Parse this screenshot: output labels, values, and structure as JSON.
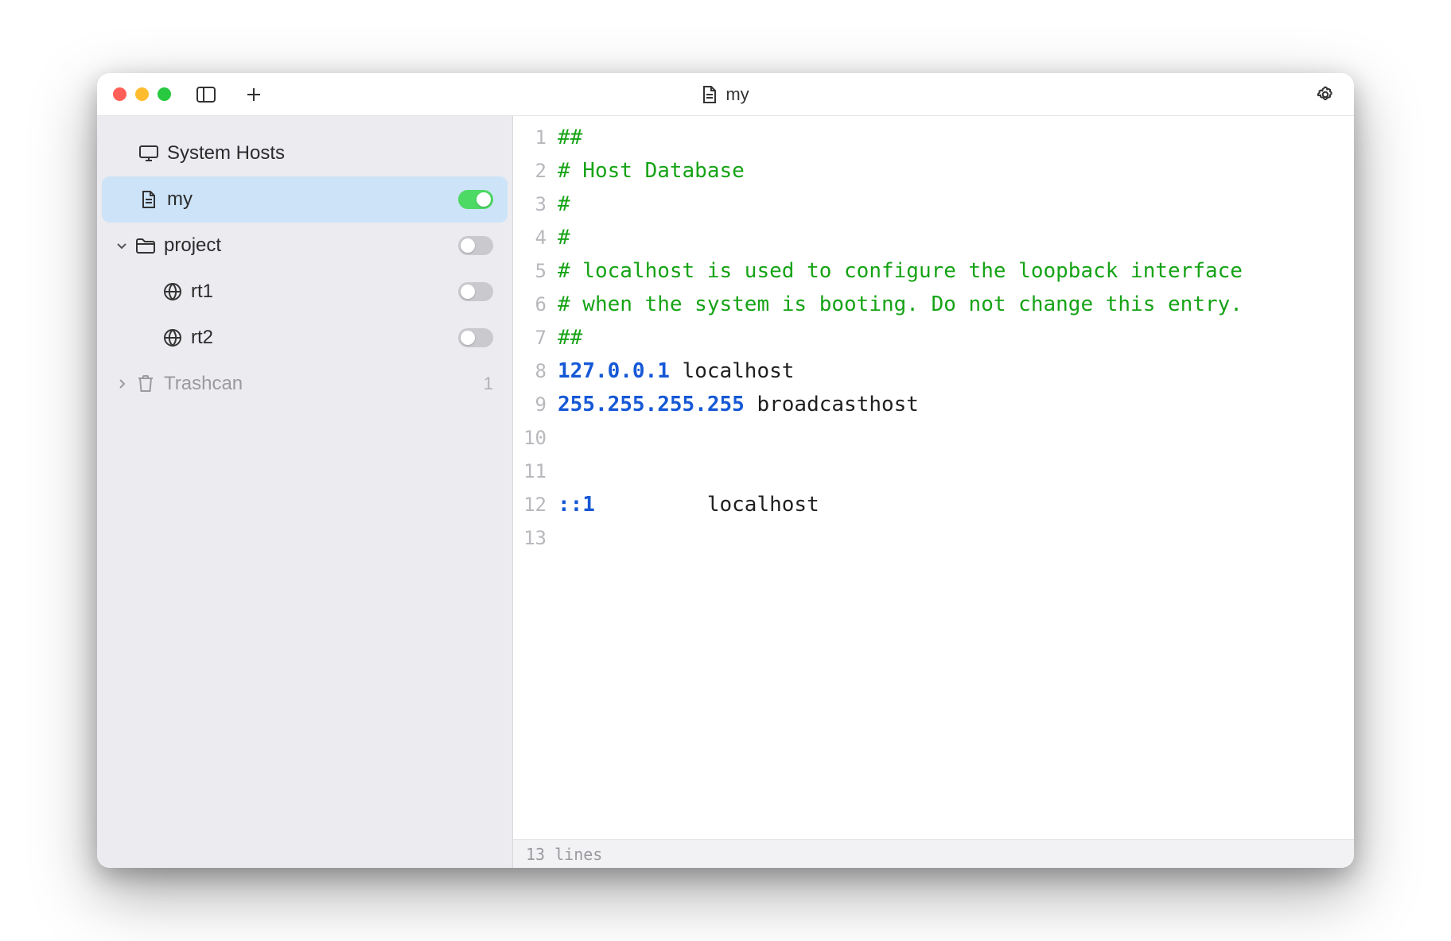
{
  "title": {
    "text": "my"
  },
  "sidebar": {
    "systemHosts": "System Hosts",
    "my": "my",
    "project": "project",
    "rt1": "rt1",
    "rt2": "rt2",
    "trashcan": "Trashcan",
    "trashCount": "1"
  },
  "editor": {
    "lines": [
      {
        "n": "1",
        "segs": [
          {
            "t": "##",
            "c": "comment"
          }
        ]
      },
      {
        "n": "2",
        "segs": [
          {
            "t": "# Host Database",
            "c": "comment"
          }
        ]
      },
      {
        "n": "3",
        "segs": [
          {
            "t": "#",
            "c": "comment"
          }
        ]
      },
      {
        "n": "4",
        "segs": [
          {
            "t": "#",
            "c": "comment"
          }
        ]
      },
      {
        "n": "5",
        "segs": [
          {
            "t": "# localhost is used to configure the loopback interface",
            "c": "comment"
          }
        ]
      },
      {
        "n": "6",
        "segs": [
          {
            "t": "# when the system is booting. Do not change this entry.",
            "c": "comment"
          }
        ]
      },
      {
        "n": "7",
        "segs": [
          {
            "t": "##",
            "c": "comment"
          }
        ]
      },
      {
        "n": "8",
        "segs": [
          {
            "t": "127.0.0.1",
            "c": "ip"
          },
          {
            "t": " localhost",
            "c": ""
          }
        ]
      },
      {
        "n": "9",
        "segs": [
          {
            "t": "255.255.255.255",
            "c": "ip"
          },
          {
            "t": " broadcasthost",
            "c": ""
          }
        ]
      },
      {
        "n": "10",
        "segs": [
          {
            "t": "",
            "c": ""
          }
        ]
      },
      {
        "n": "11",
        "segs": [
          {
            "t": "",
            "c": ""
          }
        ]
      },
      {
        "n": "12",
        "segs": [
          {
            "t": "::1",
            "c": "ip"
          },
          {
            "t": "         localhost",
            "c": ""
          }
        ]
      },
      {
        "n": "13",
        "segs": [
          {
            "t": "",
            "c": ""
          }
        ]
      }
    ]
  },
  "status": {
    "text": "13 lines"
  }
}
